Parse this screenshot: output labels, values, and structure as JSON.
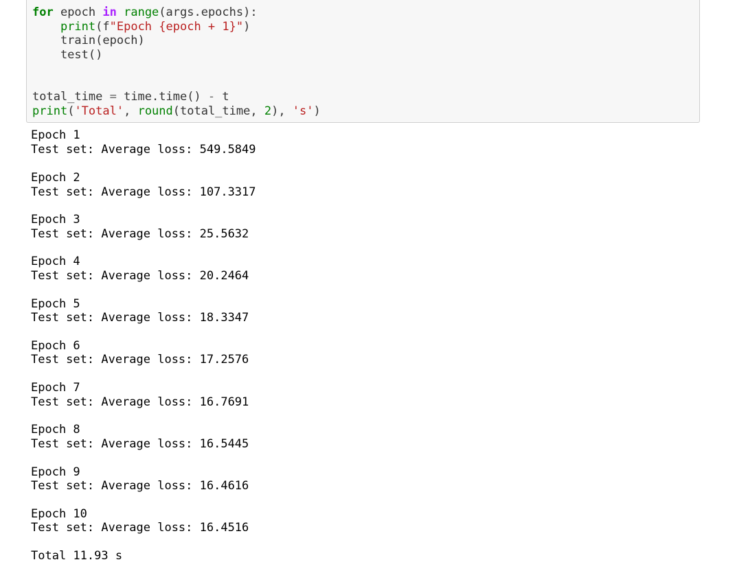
{
  "code_cell": {
    "lines": [
      {
        "parts": [
          {
            "t": "kw",
            "v": "for"
          },
          {
            "t": "txt",
            "v": " epoch "
          },
          {
            "t": "op-kw",
            "v": "in"
          },
          {
            "t": "txt",
            "v": " "
          },
          {
            "t": "bi",
            "v": "range"
          },
          {
            "t": "txt",
            "v": "(args.epochs):"
          }
        ]
      },
      {
        "parts": [
          {
            "t": "txt",
            "v": "    "
          },
          {
            "t": "bi",
            "v": "print"
          },
          {
            "t": "txt",
            "v": "(f"
          },
          {
            "t": "str",
            "v": "\"Epoch {epoch + 1}\""
          },
          {
            "t": "txt",
            "v": ")"
          }
        ]
      },
      {
        "parts": [
          {
            "t": "txt",
            "v": "    train(epoch)"
          }
        ]
      },
      {
        "parts": [
          {
            "t": "txt",
            "v": "    test()"
          }
        ]
      },
      {
        "parts": []
      },
      {
        "parts": []
      },
      {
        "parts": [
          {
            "t": "txt",
            "v": "total_time "
          },
          {
            "t": "op",
            "v": "="
          },
          {
            "t": "txt",
            "v": " time.time() "
          },
          {
            "t": "op",
            "v": "-"
          },
          {
            "t": "txt",
            "v": " t"
          }
        ]
      },
      {
        "parts": [
          {
            "t": "bi",
            "v": "print"
          },
          {
            "t": "txt",
            "v": "("
          },
          {
            "t": "str",
            "v": "'Total'"
          },
          {
            "t": "txt",
            "v": ", "
          },
          {
            "t": "bi",
            "v": "round"
          },
          {
            "t": "txt",
            "v": "(total_time, "
          },
          {
            "t": "num",
            "v": "2"
          },
          {
            "t": "txt",
            "v": "), "
          },
          {
            "t": "str",
            "v": "'s'"
          },
          {
            "t": "txt",
            "v": ")"
          }
        ]
      }
    ]
  },
  "output": {
    "lines": [
      "Epoch 1",
      "Test set: Average loss: 549.5849",
      "",
      "Epoch 2",
      "Test set: Average loss: 107.3317",
      "",
      "Epoch 3",
      "Test set: Average loss: 25.5632",
      "",
      "Epoch 4",
      "Test set: Average loss: 20.2464",
      "",
      "Epoch 5",
      "Test set: Average loss: 18.3347",
      "",
      "Epoch 6",
      "Test set: Average loss: 17.2576",
      "",
      "Epoch 7",
      "Test set: Average loss: 16.7691",
      "",
      "Epoch 8",
      "Test set: Average loss: 16.5445",
      "",
      "Epoch 9",
      "Test set: Average loss: 16.4616",
      "",
      "Epoch 10",
      "Test set: Average loss: 16.4516",
      "",
      "Total 11.93 s"
    ]
  }
}
